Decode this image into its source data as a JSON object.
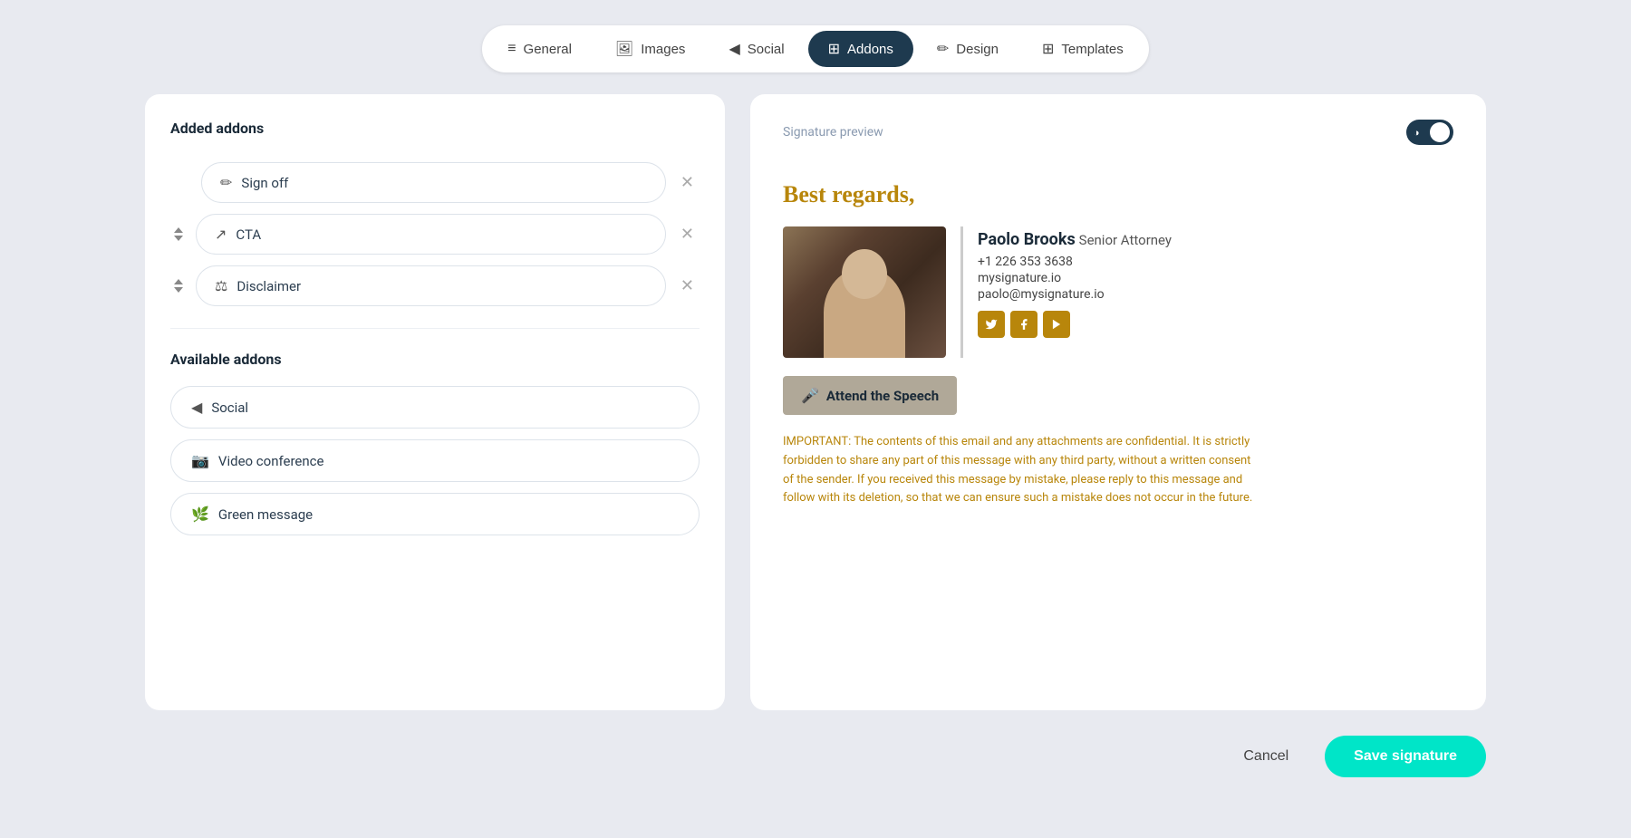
{
  "nav": {
    "tabs": [
      {
        "id": "general",
        "label": "General",
        "icon": "≡",
        "active": false
      },
      {
        "id": "images",
        "label": "Images",
        "icon": "🖼",
        "active": false
      },
      {
        "id": "social",
        "label": "Social",
        "icon": "◀",
        "active": false
      },
      {
        "id": "addons",
        "label": "Addons",
        "icon": "⊞",
        "active": true
      },
      {
        "id": "design",
        "label": "Design",
        "icon": "✏",
        "active": false
      },
      {
        "id": "templates",
        "label": "Templates",
        "icon": "⊞",
        "active": false
      }
    ]
  },
  "left_panel": {
    "added_addons_title": "Added addons",
    "added_addons": [
      {
        "id": "signoff",
        "label": "Sign off",
        "icon": "✏",
        "has_reorder": false
      },
      {
        "id": "cta",
        "label": "CTA",
        "icon": "↗",
        "has_reorder": true
      },
      {
        "id": "disclaimer",
        "label": "Disclaimer",
        "icon": "⚖",
        "has_reorder": true
      }
    ],
    "available_addons_title": "Available addons",
    "available_addons": [
      {
        "id": "social",
        "label": "Social",
        "icon": "◀"
      },
      {
        "id": "video_conference",
        "label": "Video conference",
        "icon": "📷"
      },
      {
        "id": "green_message",
        "label": "Green message",
        "icon": "🌿"
      }
    ]
  },
  "right_panel": {
    "preview_label": "Signature preview",
    "toggle_state": "dark",
    "signature": {
      "signoff": "Best regards,",
      "name": "Paolo Brooks",
      "role": "Senior Attorney",
      "phone": "+1 226 353 3638",
      "website": "mysignature.io",
      "email": "paolo@mysignature.io",
      "socials": [
        "twitter",
        "facebook",
        "youtube"
      ],
      "cta_label": "Attend the Speech",
      "disclaimer": "IMPORTANT: The contents of this email and any attachments are confidential. It is strictly forbidden to share any part of this message with any third party, without a written consent of the sender. If you received this message by mistake, please reply to this message and follow with its deletion, so that we can ensure such a mistake does not occur in the future."
    }
  },
  "footer": {
    "cancel_label": "Cancel",
    "save_label": "Save signature"
  }
}
